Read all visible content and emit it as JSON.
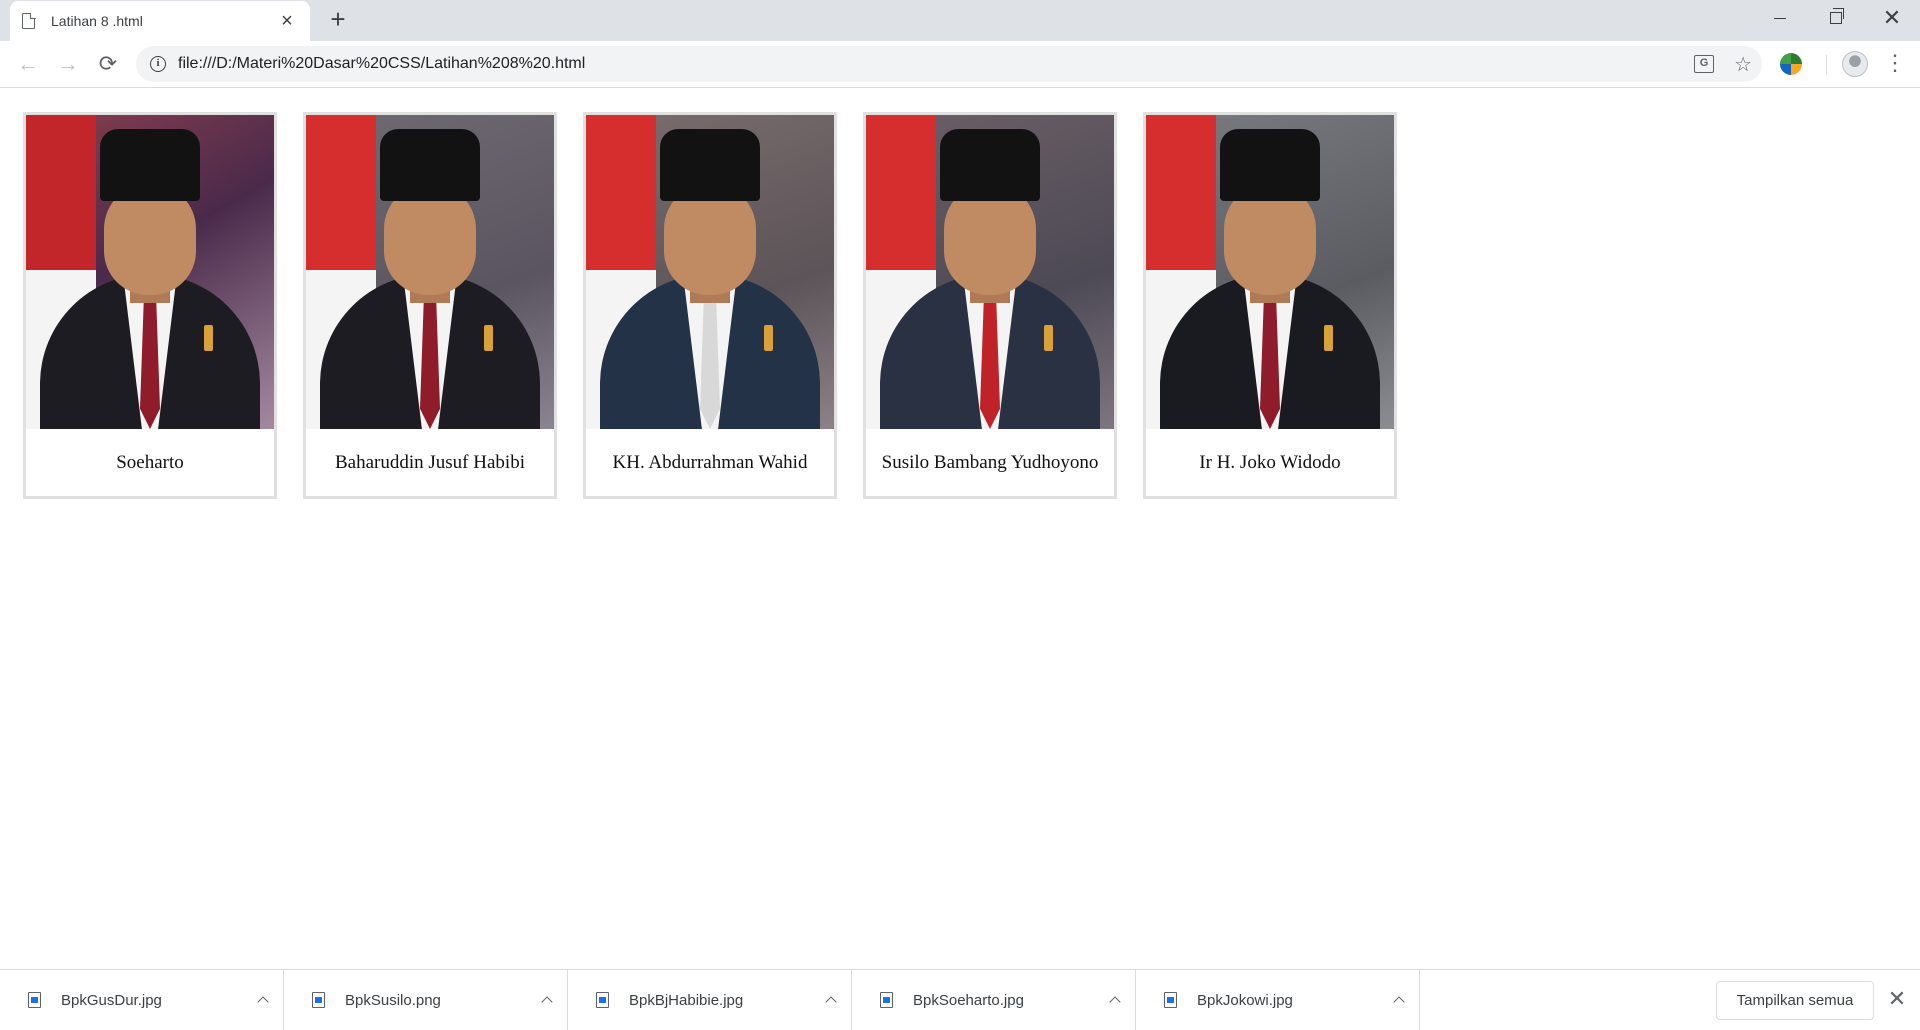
{
  "tab": {
    "title": "Latihan 8 .html",
    "close": "×",
    "new_tab": "+"
  },
  "window_controls": {
    "close": "✕"
  },
  "toolbar": {
    "back": "←",
    "forward": "→",
    "reload": "⟳",
    "url": "file:///D:/Materi%20Dasar%20CSS/Latihan%208%20.html",
    "info": "i",
    "translate": "G",
    "star": "☆",
    "menu": "⋮"
  },
  "gallery": {
    "cards": [
      {
        "name": "Soeharto"
      },
      {
        "name": "Baharuddin Jusuf Habibi"
      },
      {
        "name": "KH. Abdurrahman Wahid"
      },
      {
        "name": "Susilo Bambang Yudhoyono"
      },
      {
        "name": "Ir H. Joko Widodo"
      }
    ]
  },
  "downloads": {
    "items": [
      {
        "filename": "BpkGusDur.jpg"
      },
      {
        "filename": "BpkSusilo.png"
      },
      {
        "filename": "BpkBjHabibie.jpg"
      },
      {
        "filename": "BpkSoeharto.jpg"
      },
      {
        "filename": "BpkJokowi.jpg"
      }
    ],
    "show_all_label": "Tampilkan semua",
    "close": "✕"
  }
}
